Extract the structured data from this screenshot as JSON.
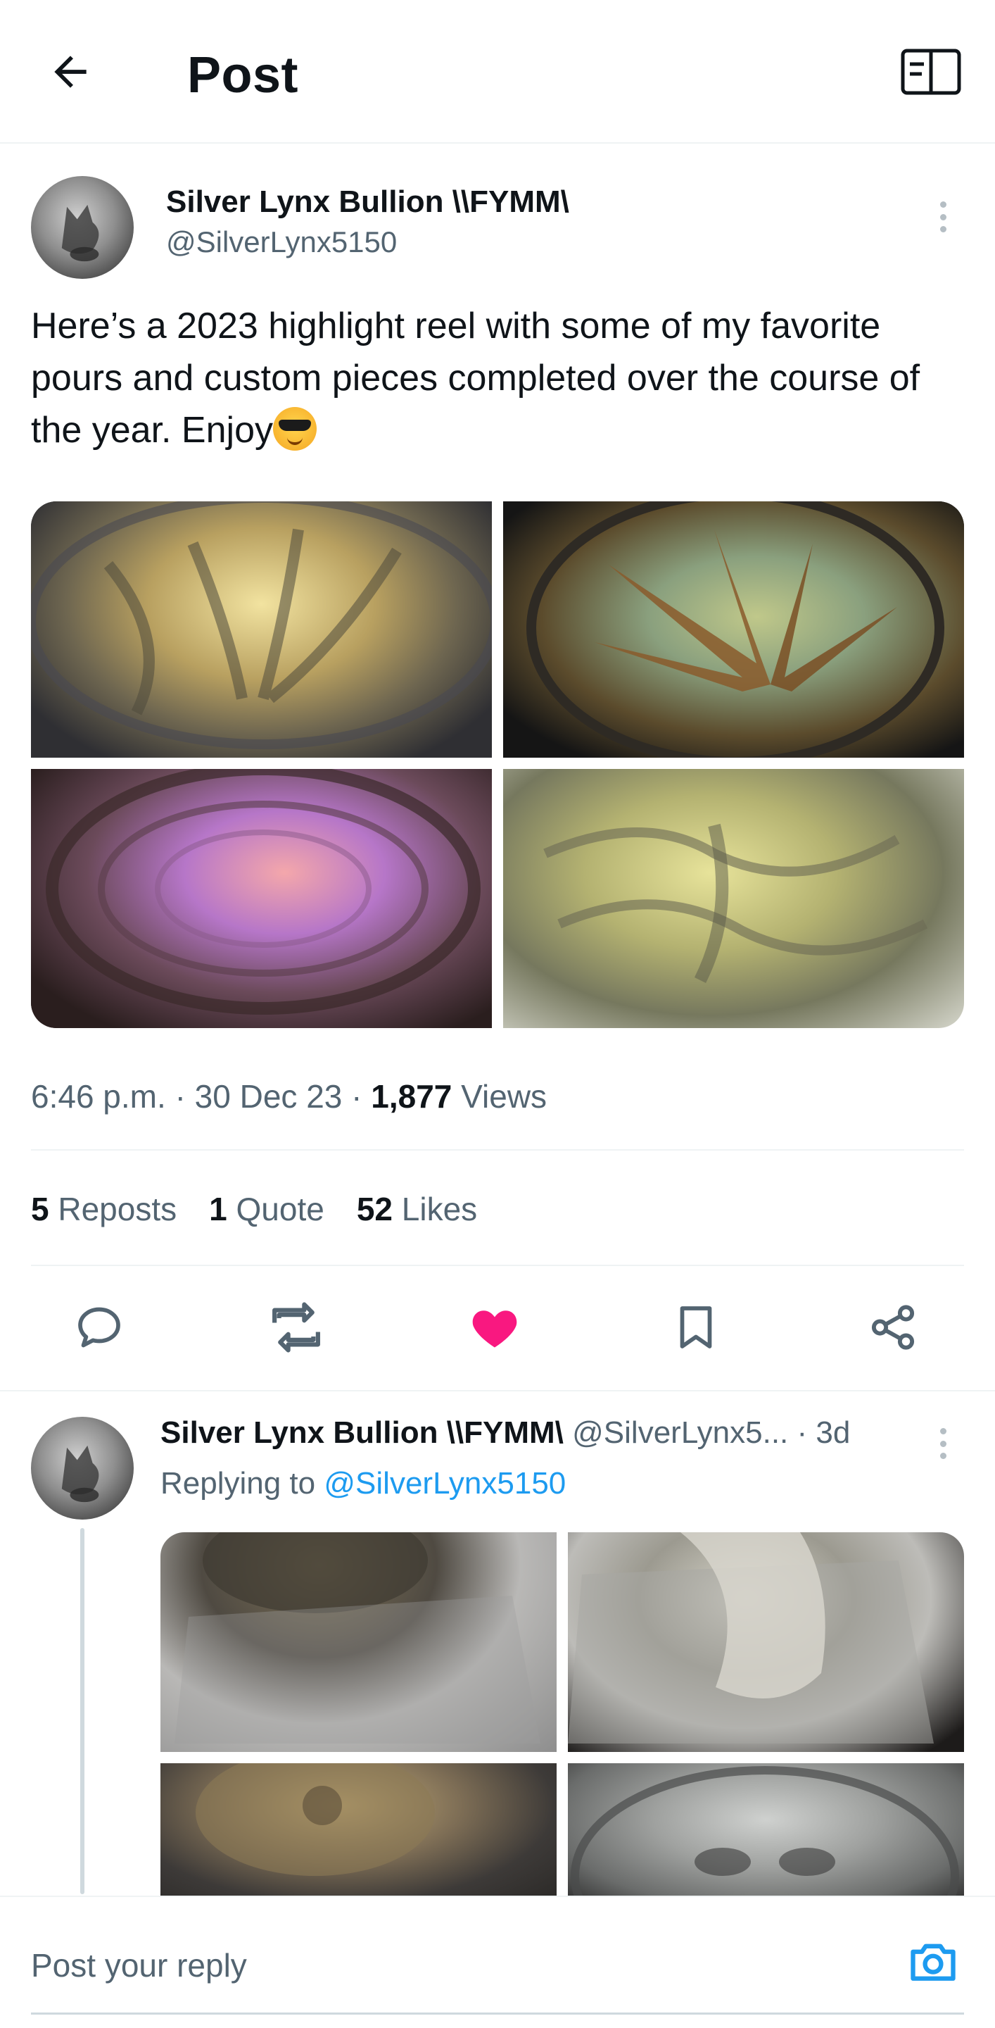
{
  "header": {
    "title": "Post",
    "back_icon": "arrow-left-icon",
    "reader_icon": "reader-mode-icon"
  },
  "post": {
    "author_name": "Silver Lynx Bullion \\\\FYMM\\",
    "author_handle": "@SilverLynx5150",
    "text": "Here’s a 2023 highlight reel with some of my favorite pours and custom pieces completed over the course of the year. Enjoy",
    "emoji": "smiling-face-with-sunglasses",
    "time": "6:46 p.m.",
    "date": "30 Dec 23",
    "views_count": "1,877",
    "views_label": "Views",
    "separator": "·"
  },
  "stats": {
    "reposts_count": "5",
    "reposts_label": "Reposts",
    "quotes_count": "1",
    "quotes_label": "Quote",
    "likes_count": "52",
    "likes_label": "Likes"
  },
  "actions": {
    "liked": true,
    "like_color": "#f91880",
    "icon_color": "#536471"
  },
  "reply": {
    "author_name": "Silver Lynx Bullion \\\\FYMM\\",
    "author_handle": "@SilverLynx5...",
    "age": "· 3d",
    "replying_prefix": "Replying to",
    "replying_to": "@SilverLynx5150"
  },
  "composer": {
    "placeholder": "Post your reply",
    "accent": "#1d9bf0"
  }
}
